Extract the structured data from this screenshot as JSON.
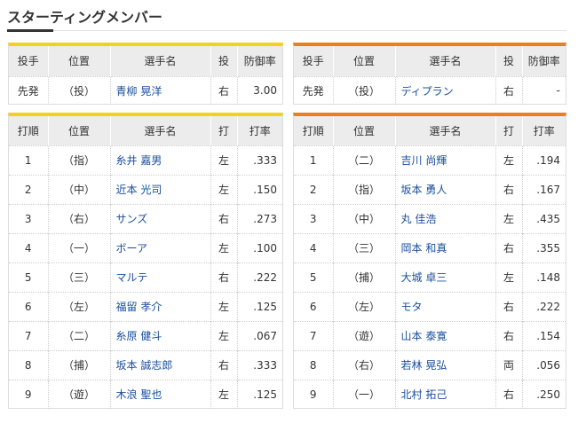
{
  "page": {
    "title": "スターティングメンバー"
  },
  "pitchers": {
    "headers": [
      "投手",
      "位置",
      "選手名",
      "投",
      "防御率"
    ],
    "home": {
      "role": "先発",
      "pos": "（投）",
      "name": "青柳 晃洋",
      "hand": "右",
      "era": "3.00"
    },
    "away": {
      "role": "先発",
      "pos": "（投）",
      "name": "ディプラン",
      "hand": "右",
      "era": "-"
    }
  },
  "lineups": {
    "headers": [
      "打順",
      "位置",
      "選手名",
      "打",
      "打率"
    ],
    "home": [
      {
        "order": "1",
        "pos": "（指）",
        "name": "糸井 嘉男",
        "bat": "左",
        "avg": ".333"
      },
      {
        "order": "2",
        "pos": "（中）",
        "name": "近本 光司",
        "bat": "左",
        "avg": ".150"
      },
      {
        "order": "3",
        "pos": "（右）",
        "name": "サンズ",
        "bat": "右",
        "avg": ".273"
      },
      {
        "order": "4",
        "pos": "（一）",
        "name": "ボーア",
        "bat": "左",
        "avg": ".100"
      },
      {
        "order": "5",
        "pos": "（三）",
        "name": "マルテ",
        "bat": "右",
        "avg": ".222"
      },
      {
        "order": "6",
        "pos": "（左）",
        "name": "福留 孝介",
        "bat": "左",
        "avg": ".125"
      },
      {
        "order": "7",
        "pos": "（二）",
        "name": "糸原 健斗",
        "bat": "左",
        "avg": ".067"
      },
      {
        "order": "8",
        "pos": "（捕）",
        "name": "坂本 誠志郎",
        "bat": "右",
        "avg": ".333"
      },
      {
        "order": "9",
        "pos": "（遊）",
        "name": "木浪 聖也",
        "bat": "左",
        "avg": ".125"
      }
    ],
    "away": [
      {
        "order": "1",
        "pos": "（二）",
        "name": "吉川 尚輝",
        "bat": "左",
        "avg": ".194"
      },
      {
        "order": "2",
        "pos": "（指）",
        "name": "坂本 勇人",
        "bat": "右",
        "avg": ".167"
      },
      {
        "order": "3",
        "pos": "（中）",
        "name": "丸 佳浩",
        "bat": "左",
        "avg": ".435"
      },
      {
        "order": "4",
        "pos": "（三）",
        "name": "岡本 和真",
        "bat": "右",
        "avg": ".355"
      },
      {
        "order": "5",
        "pos": "（捕）",
        "name": "大城 卓三",
        "bat": "左",
        "avg": ".148"
      },
      {
        "order": "6",
        "pos": "（左）",
        "name": "モタ",
        "bat": "右",
        "avg": ".222"
      },
      {
        "order": "7",
        "pos": "（遊）",
        "name": "山本 泰寛",
        "bat": "右",
        "avg": ".154"
      },
      {
        "order": "8",
        "pos": "（右）",
        "name": "若林 晃弘",
        "bat": "両",
        "avg": ".056"
      },
      {
        "order": "9",
        "pos": "（一）",
        "name": "北村 拓己",
        "bat": "右",
        "avg": ".250"
      }
    ]
  },
  "colors": {
    "home_accent": "#f3d21c",
    "away_accent": "#eb7f1c",
    "link": "#1a4fa0",
    "header_bg": "#ececec"
  }
}
